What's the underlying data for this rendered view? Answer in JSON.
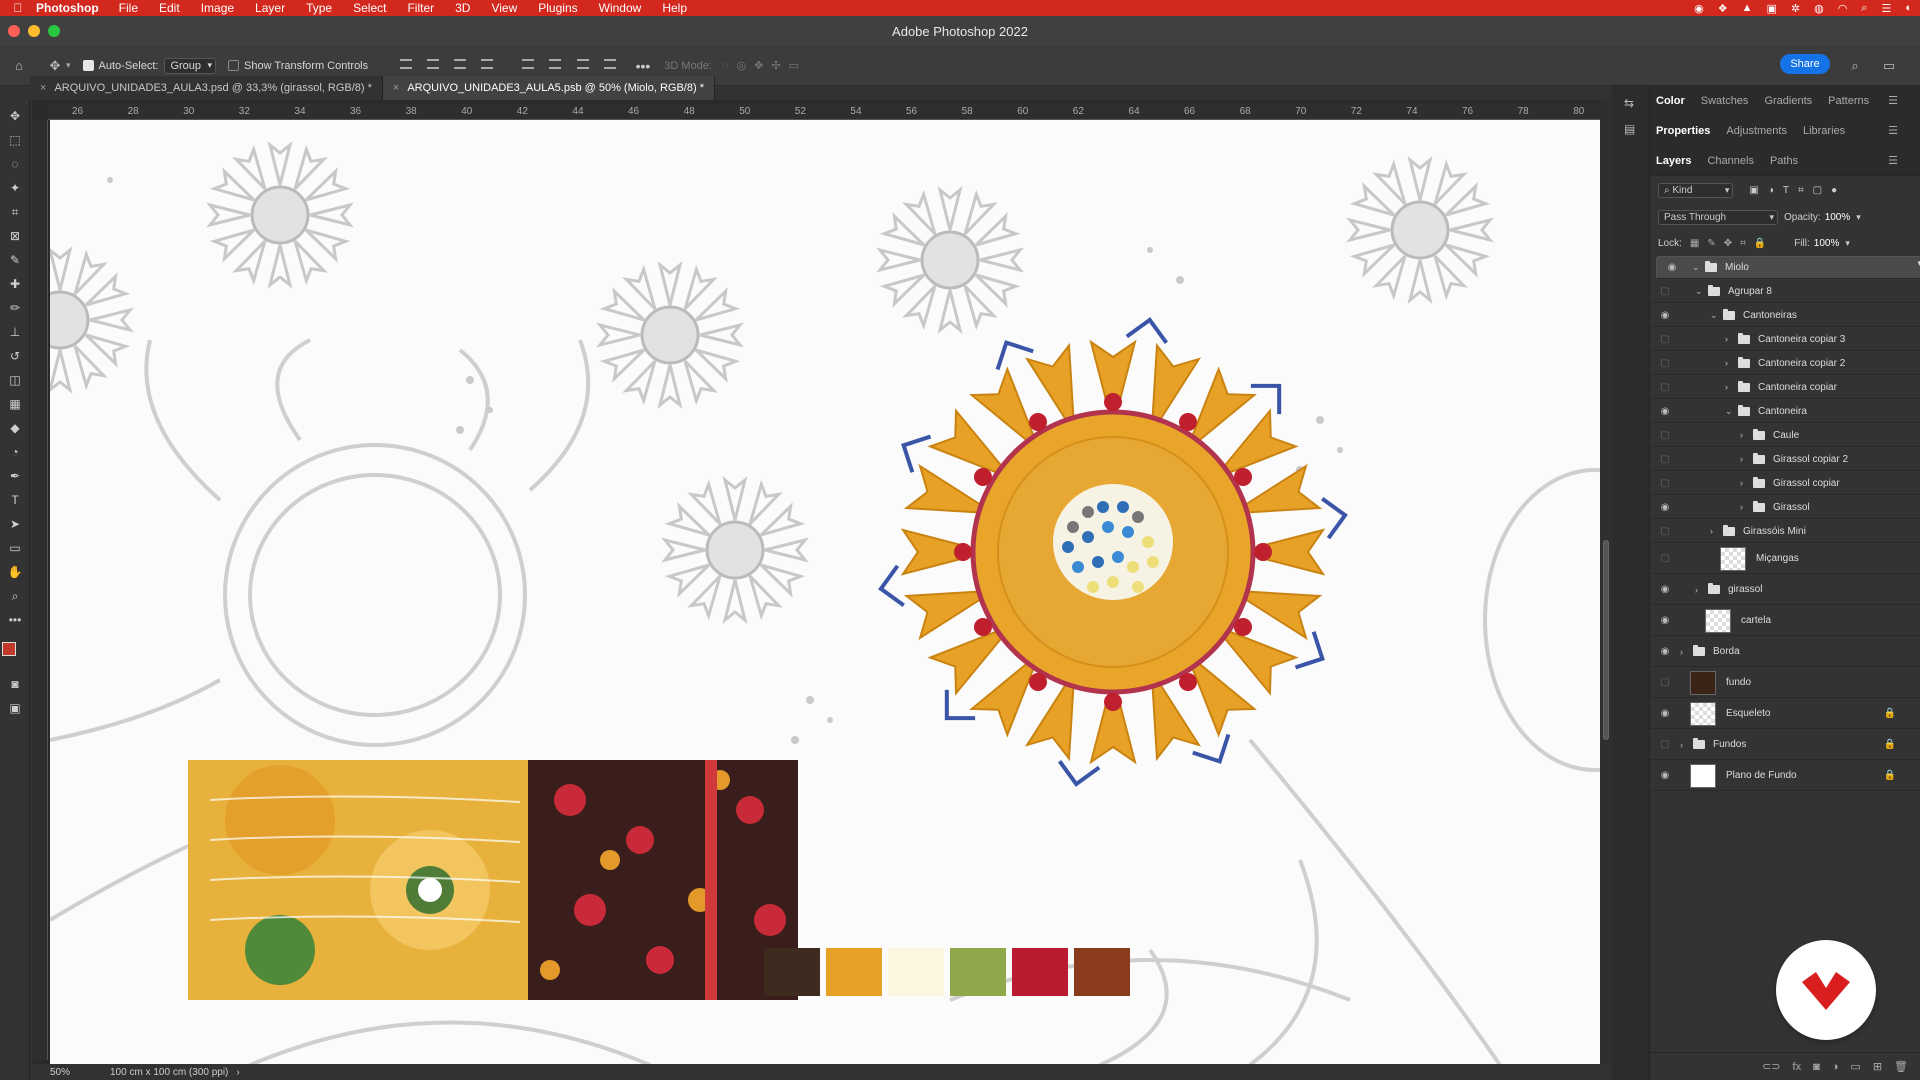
{
  "menubar": {
    "app": "Photoshop",
    "items": [
      "File",
      "Edit",
      "Image",
      "Layer",
      "Type",
      "Select",
      "Filter",
      "3D",
      "View",
      "Plugins",
      "Window",
      "Help"
    ]
  },
  "window_title": "Adobe Photoshop 2022",
  "options": {
    "auto_select_label": "Auto-Select:",
    "auto_select_value": "Group",
    "transform_label": "Show Transform Controls",
    "mode3d_label": "3D Mode:",
    "share_label": "Share"
  },
  "tabs": [
    {
      "label": "ARQUIVO_UNIDADE3_AULA3.psd @ 33,3% (girassol, RGB/8) *"
    },
    {
      "label": "ARQUIVO_UNIDADE3_AULA5.psb @ 50% (Miolo, RGB/8) *"
    }
  ],
  "ruler_ticks": [
    "26",
    "28",
    "30",
    "32",
    "34",
    "36",
    "38",
    "40",
    "42",
    "44",
    "46",
    "48",
    "50",
    "52",
    "54",
    "56",
    "58",
    "60",
    "62",
    "64",
    "66",
    "68",
    "70",
    "72",
    "74",
    "76",
    "78",
    "80"
  ],
  "status": {
    "zoom": "50%",
    "doc_size": "100 cm x 100 cm (300 ppi)"
  },
  "panels": {
    "top_tabs": [
      "Color",
      "Swatches",
      "Gradients",
      "Patterns"
    ],
    "mid_tabs": [
      "Properties",
      "Adjustments",
      "Libraries"
    ],
    "layer_tabs": [
      "Layers",
      "Channels",
      "Paths"
    ],
    "filter_kind": "Kind",
    "blend_mode": "Pass Through",
    "opacity_label": "Opacity:",
    "opacity_value": "100%",
    "lock_label": "Lock:",
    "fill_label": "Fill:",
    "fill_value": "100%"
  },
  "layers": [
    {
      "name": "Miolo",
      "indent": 0,
      "type": "folder",
      "open": true,
      "visible": true,
      "selected": true
    },
    {
      "name": "Agrupar 8",
      "indent": 1,
      "type": "folder",
      "open": true,
      "visible": false
    },
    {
      "name": "Cantoneiras",
      "indent": 2,
      "type": "folder",
      "open": true,
      "visible": true
    },
    {
      "name": "Cantoneira copiar 3",
      "indent": 3,
      "type": "folder",
      "open": false,
      "visible": false
    },
    {
      "name": "Cantoneira copiar 2",
      "indent": 3,
      "type": "folder",
      "open": false,
      "visible": false
    },
    {
      "name": "Cantoneira copiar",
      "indent": 3,
      "type": "folder",
      "open": false,
      "visible": false
    },
    {
      "name": "Cantoneira",
      "indent": 3,
      "type": "folder",
      "open": true,
      "visible": true
    },
    {
      "name": "Caule",
      "indent": 4,
      "type": "folder",
      "open": false,
      "visible": false
    },
    {
      "name": "Girassol copiar 2",
      "indent": 4,
      "type": "folder",
      "open": false,
      "visible": false
    },
    {
      "name": "Girassol copiar",
      "indent": 4,
      "type": "folder",
      "open": false,
      "visible": false
    },
    {
      "name": "Girassol",
      "indent": 4,
      "type": "folder",
      "open": false,
      "visible": true
    },
    {
      "name": "Girassóis Mini",
      "indent": 2,
      "type": "folder",
      "open": false,
      "visible": false
    },
    {
      "name": "Miçangas",
      "indent": 2,
      "type": "pixel",
      "visible": false
    },
    {
      "name": "girassol",
      "indent": 1,
      "type": "folder",
      "open": false,
      "visible": true
    },
    {
      "name": "cartela",
      "indent": 1,
      "type": "pixel",
      "visible": true
    },
    {
      "name": "Borda",
      "indent": 0,
      "type": "folder",
      "open": false,
      "visible": true
    },
    {
      "name": "fundo",
      "indent": 0,
      "type": "pixel",
      "visible": false,
      "thumb": "#3a2418"
    },
    {
      "name": "Esqueleto",
      "indent": 0,
      "type": "pixel",
      "visible": true,
      "locked": true
    },
    {
      "name": "Fundos",
      "indent": 0,
      "type": "folder",
      "open": false,
      "visible": false,
      "locked": true
    },
    {
      "name": "Plano de Fundo",
      "indent": 0,
      "type": "pixel",
      "visible": true,
      "locked": true,
      "thumb": "#ffffff"
    }
  ],
  "palette": [
    "#3f2a1f",
    "#e8a127",
    "#fbf6e0",
    "#8fa84a",
    "#b81c2e",
    "#8b3c1e"
  ],
  "colors": {
    "accent": "#1473e6",
    "menubar": "#d2281e",
    "fg_swatch": "#c0392b"
  }
}
